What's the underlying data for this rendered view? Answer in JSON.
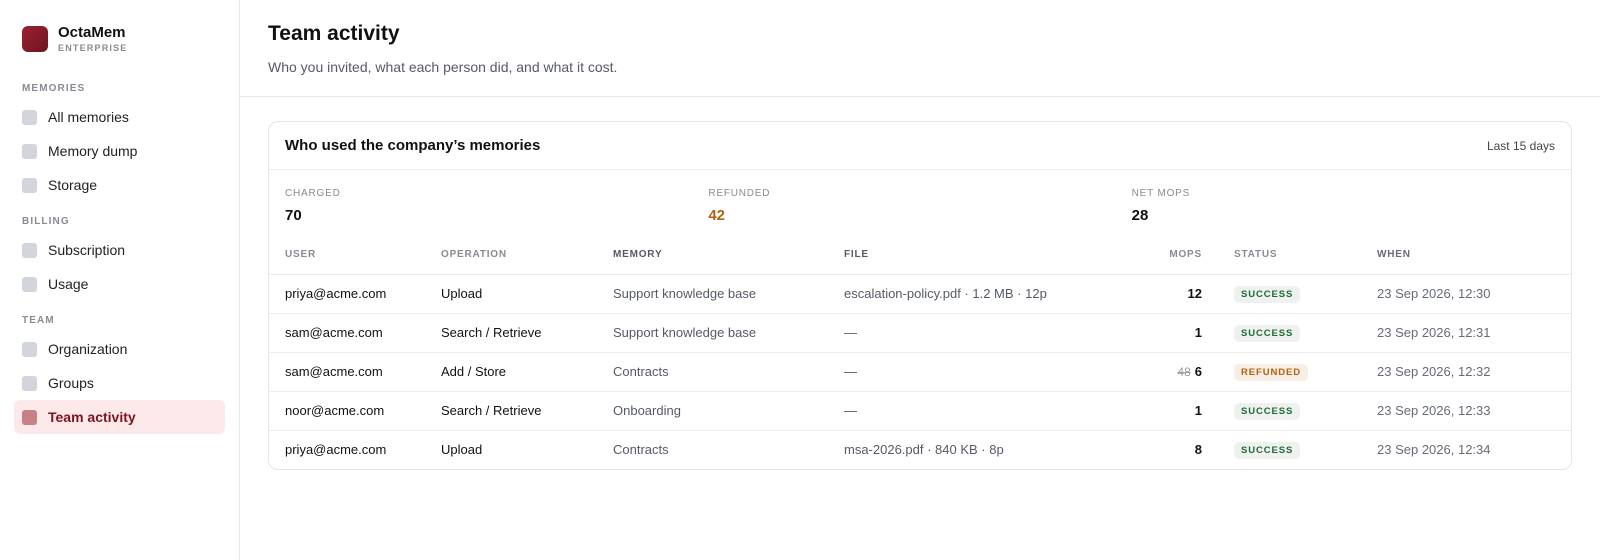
{
  "brand": {
    "name": "OctaMem",
    "sub": "ENTERPRISE"
  },
  "sidebar": {
    "sections": [
      {
        "title": "MEMORIES",
        "items": [
          {
            "label": "All memories"
          },
          {
            "label": "Memory dump"
          },
          {
            "label": "Storage"
          }
        ]
      },
      {
        "title": "BILLING",
        "items": [
          {
            "label": "Subscription"
          },
          {
            "label": "Usage"
          }
        ]
      },
      {
        "title": "TEAM",
        "items": [
          {
            "label": "Organization"
          },
          {
            "label": "Groups"
          },
          {
            "label": "Team activity",
            "active": true
          }
        ]
      }
    ]
  },
  "header": {
    "title": "Team activity",
    "subtitle": "Who you invited, what each person did, and what it cost."
  },
  "card": {
    "title": "Who used the company’s memories",
    "range": "Last 15 days",
    "stats": [
      {
        "label": "CHARGED",
        "value": "70"
      },
      {
        "label": "REFUNDED",
        "value": "42"
      },
      {
        "label": "NET MOPS",
        "value": "28"
      }
    ]
  },
  "table": {
    "columns": {
      "user": "USER",
      "operation": "OPERATION",
      "memory": "MEMORY",
      "file": "FILE",
      "mops": "MOPS",
      "status": "STATUS",
      "when": "WHEN"
    },
    "rows": [
      {
        "user": "priya@acme.com",
        "operation": "Upload",
        "memory": "Support knowledge base",
        "file": "escalation-policy.pdf · 1.2 MB · 12p",
        "mops_old": "",
        "mops": "12",
        "status": "SUCCESS",
        "when": "23 Sep 2026, 12:30"
      },
      {
        "user": "sam@acme.com",
        "operation": "Search / Retrieve",
        "memory": "Support knowledge base",
        "file": "—",
        "mops_old": "",
        "mops": "1",
        "status": "SUCCESS",
        "when": "23 Sep 2026, 12:31"
      },
      {
        "user": "sam@acme.com",
        "operation": "Add / Store",
        "memory": "Contracts",
        "file": "—",
        "mops_old": "48",
        "mops": "6",
        "status": "REFUNDED",
        "when": "23 Sep 2026, 12:32"
      },
      {
        "user": "noor@acme.com",
        "operation": "Search / Retrieve",
        "memory": "Onboarding",
        "file": "—",
        "mops_old": "",
        "mops": "1",
        "status": "SUCCESS",
        "when": "23 Sep 2026, 12:33"
      },
      {
        "user": "priya@acme.com",
        "operation": "Upload",
        "memory": "Contracts",
        "file": "msa-2026.pdf · 840 KB · 8p",
        "mops_old": "",
        "mops": "8",
        "status": "SUCCESS",
        "when": "23 Sep 2026, 12:34"
      }
    ]
  },
  "colors": {
    "accent": "#8b1c2b",
    "active_bg": "#fde9ea",
    "refund": "#b4600e",
    "success": "#1d6b34"
  }
}
